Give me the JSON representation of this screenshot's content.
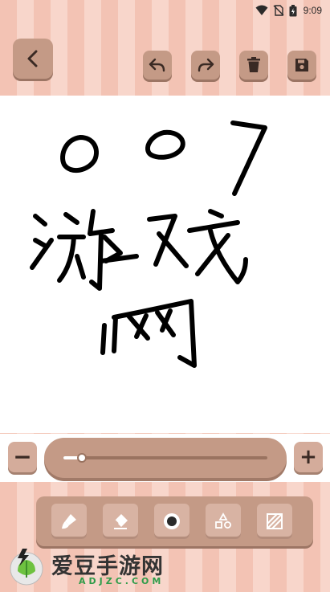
{
  "status_bar": {
    "time": "9:09",
    "icons": [
      "wifi-icon",
      "no-sim-icon",
      "battery-icon"
    ]
  },
  "toolbar": {
    "back": "chevron-left-icon",
    "undo": "undo-icon",
    "redo": "redo-icon",
    "delete": "trash-icon",
    "save": "save-icon"
  },
  "brush_size": {
    "decrease_label": "−",
    "increase_label": "+",
    "value": 0.09
  },
  "tools": [
    {
      "name": "brush",
      "icon": "brush-icon"
    },
    {
      "name": "eraser",
      "icon": "eraser-icon"
    },
    {
      "name": "brush-dot",
      "icon": "brush-dot-icon"
    },
    {
      "name": "shapes",
      "icon": "shapes-icon"
    },
    {
      "name": "pattern",
      "icon": "pattern-icon"
    }
  ],
  "watermark": {
    "title": "爱豆手游网",
    "subtitle": "ADJZC.COM"
  },
  "colors": {
    "accent": "#c49a86",
    "stripe_a": "#f3c3b4",
    "stripe_b": "#f8d6cb",
    "icon_dark": "#3a2a24",
    "watermark_green": "#2f9c4a"
  }
}
